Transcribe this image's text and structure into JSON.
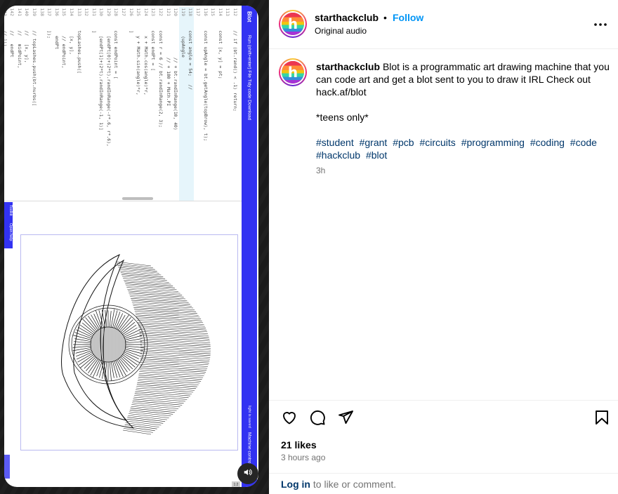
{
  "media": {
    "editor": {
      "logo": "Blot",
      "menu": "Run (shift+enter)   File   Tidy code   Download",
      "machine": "Machine control",
      "status": "light is saved",
      "tools_label": "Toolkit",
      "open_help": "Open help",
      "corner_badge": "1:2",
      "code_lines": [
        {
          "n": "112",
          "t": "    // if (bt.rand() < .1) return;"
        },
        {
          "n": "113",
          "t": ""
        },
        {
          "n": "114",
          "t": "    const [x, y] = pt;"
        },
        {
          "n": "115",
          "t": ""
        },
        {
          "n": "116",
          "t": "    const upAngle = bt.getAngle(topBrow), t);"
        },
        {
          "n": "117",
          "t": ""
        },
        {
          "n": "118",
          "t": "    const angle = 54;   //"
        },
        {
          "n": "119",
          "t": "      (upAngle"
        },
        {
          "n": "120",
          "t": "              // + bt.randInRange(10, 40)"
        },
        {
          "n": "121",
          "t": "              // + 180 + Math.PI"
        },
        {
          "n": "122",
          "t": "    const r = 6 // bt.randInRange(2, 3);"
        },
        {
          "n": "123",
          "t": "    const endPt = ["
        },
        {
          "n": "124",
          "t": "      x + Math.cos(angle)*r,"
        },
        {
          "n": "125",
          "t": "      y + Math.sin(angle)*r,"
        },
        {
          "n": "126",
          "t": "    ]"
        },
        {
          "n": "127",
          "t": ""
        },
        {
          "n": "128",
          "t": "    const endPoint = ["
        },
        {
          "n": "129",
          "t": "      [endPt[0]+(2*t).randInRange(-r*.6, r*.6),"
        },
        {
          "n": "130",
          "t": "      [endPt[1]+(2*t).randInRange(-1, 1)]"
        },
        {
          "n": "131",
          "t": "    ]"
        },
        {
          "n": "132",
          "t": ""
        },
        {
          "n": "133",
          "t": "    topLashes.push(["
        },
        {
          "n": "134",
          "t": "      [x, y],"
        },
        {
          "n": "135",
          "t": "      // endPoint,"
        },
        {
          "n": "136",
          "t": "      endPt"
        },
        {
          "n": "137",
          "t": "    ]);"
        },
        {
          "n": "138",
          "t": ""
        },
        {
          "n": "139",
          "t": "    // topLashes.push(bt.nurbs(["
        },
        {
          "n": "140",
          "t": "    //   [x, y],"
        },
        {
          "n": "141",
          "t": "    //   midPoint,"
        },
        {
          "n": "142",
          "t": "    //   endPt"
        },
        {
          "n": "143",
          "t": "    // ]))"
        },
        {
          "n": "144",
          "t": ""
        },
        {
          "n": "145",
          "t": "})"
        },
        {
          "n": "146",
          "t": ""
        },
        {
          "n": "147",
          "t": "bt.join(polylines, topLashes);"
        }
      ]
    }
  },
  "post": {
    "username": "starthackclub",
    "dot": "•",
    "follow": "Follow",
    "audio": "Original audio",
    "avatar_letter": "h",
    "caption_text": "Blot is a programmatic art drawing machine that you can code art and get a blot sent to you to draw it IRL Check out hack.af/blot",
    "teens": "*teens only*",
    "hashtags": [
      "#student",
      "#grant",
      "#pcb",
      "#circuits",
      "#programming",
      "#coding",
      "#code",
      "#hackclub",
      "#blot"
    ],
    "time_ago": "3h",
    "likes": "21 likes",
    "posted": "3 hours ago",
    "login": "Log in",
    "login_rest": "to like or comment."
  },
  "icons": {
    "more": "more-icon",
    "like": "heart-icon",
    "comment": "comment-icon",
    "share": "share-icon",
    "save": "bookmark-icon",
    "mute": "speaker-icon"
  },
  "colors": {
    "accent": "#0095f6",
    "link": "#00376b",
    "muted": "#737373",
    "editor_blue": "#3232f2"
  }
}
